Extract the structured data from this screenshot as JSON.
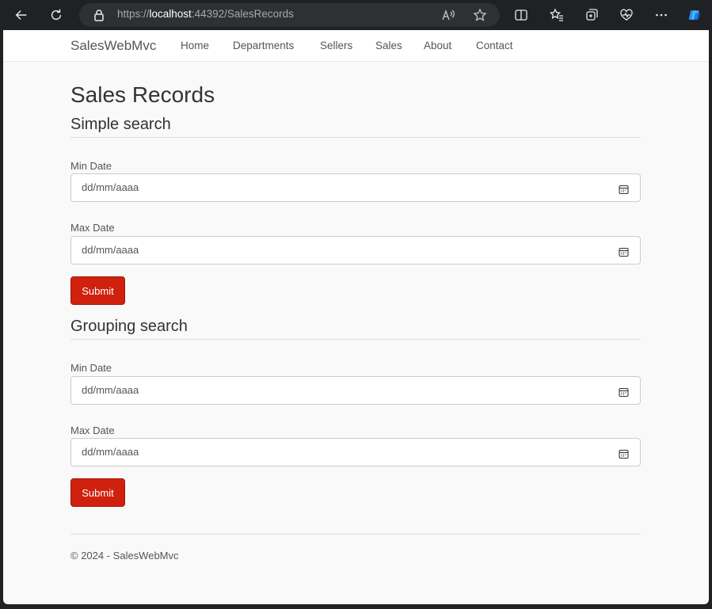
{
  "browser": {
    "url_scheme": "https://",
    "url_host": "localhost",
    "url_rest": ":44392/SalesRecords"
  },
  "navbar": {
    "brand": "SalesWebMvc",
    "links": [
      "Home",
      "Departments",
      "Sellers",
      "Sales",
      "About",
      "Contact"
    ]
  },
  "main": {
    "title": "Sales Records",
    "simple": {
      "heading": "Simple search",
      "min_label": "Min Date",
      "min_placeholder": "dd/mm/aaaa",
      "max_label": "Max Date",
      "max_placeholder": "dd/mm/aaaa",
      "submit": "Submit"
    },
    "grouping": {
      "heading": "Grouping search",
      "min_label": "Min Date",
      "min_placeholder": "dd/mm/aaaa",
      "max_label": "Max Date",
      "max_placeholder": "dd/mm/aaaa",
      "submit": "Submit"
    }
  },
  "footer": {
    "text": "© 2024 - SalesWebMvc"
  },
  "colors": {
    "submit_button": "#d0200e",
    "page_background": "#f9f9f9"
  }
}
